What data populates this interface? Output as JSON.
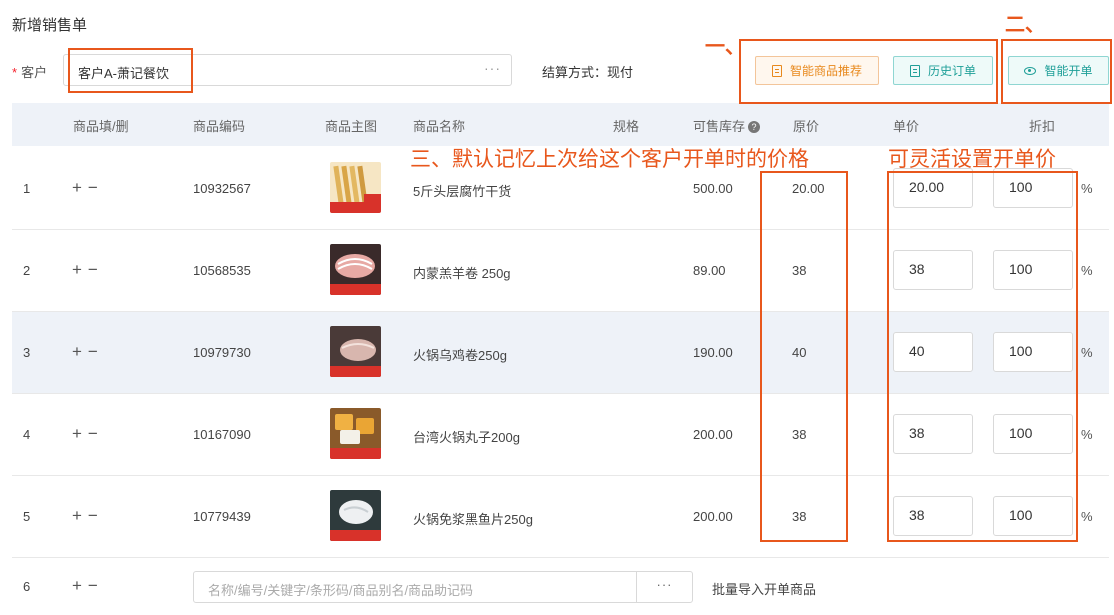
{
  "page": {
    "title": "新增销售单"
  },
  "customer": {
    "label": "客户",
    "value": "客户A-萧记餐饮",
    "more": "···"
  },
  "settlement": {
    "text": "结算方式：现付"
  },
  "buttons": {
    "smart_recommend": "智能商品推荐",
    "history_orders": "历史订单",
    "smart_order": "智能开单"
  },
  "annotations": {
    "one": "一、",
    "two": "二、",
    "three": "三、默认记忆上次给这个客户开单时的价格",
    "flexible": "可灵活设置开单价"
  },
  "table": {
    "headers": [
      "商品填/删",
      "商品编码",
      "商品主图",
      "商品名称",
      "规格",
      "可售库存",
      "原价",
      "单价",
      "折扣"
    ],
    "help_icon": "?",
    "rows": [
      {
        "no": "1",
        "ops": "+−",
        "code": "10932567",
        "name": "5斤头层腐竹干货",
        "stock": "500.00",
        "orig": "20.00",
        "price": "20.00",
        "discount": "100",
        "pct": "%"
      },
      {
        "no": "2",
        "ops": "+−",
        "code": "10568535",
        "name": "内蒙羔羊卷 250g",
        "stock": "89.00",
        "orig": "38",
        "price": "38",
        "discount": "100",
        "pct": "%"
      },
      {
        "no": "3",
        "ops": "+−",
        "code": "10979730",
        "name": "火锅乌鸡卷250g",
        "stock": "190.00",
        "orig": "40",
        "price": "40",
        "discount": "100",
        "pct": "%"
      },
      {
        "no": "4",
        "ops": "+−",
        "code": "10167090",
        "name": "台湾火锅丸子200g",
        "stock": "200.00",
        "orig": "38",
        "price": "38",
        "discount": "100",
        "pct": "%"
      },
      {
        "no": "5",
        "ops": "+−",
        "code": "10779439",
        "name": "火锅免浆黑鱼片250g",
        "stock": "200.00",
        "orig": "38",
        "price": "38",
        "discount": "100",
        "pct": "%"
      }
    ],
    "new_row": {
      "no": "6",
      "ops": "+−",
      "search_placeholder": "名称/编号/关键字/条形码/商品别名/商品助记码",
      "more": "···",
      "batch_import": "批量导入开单商品"
    }
  },
  "colors": {
    "annotation": "#e8571c",
    "header_bg": "#eef2f8",
    "orange": "#e8891d",
    "teal": "#1f9f98"
  }
}
